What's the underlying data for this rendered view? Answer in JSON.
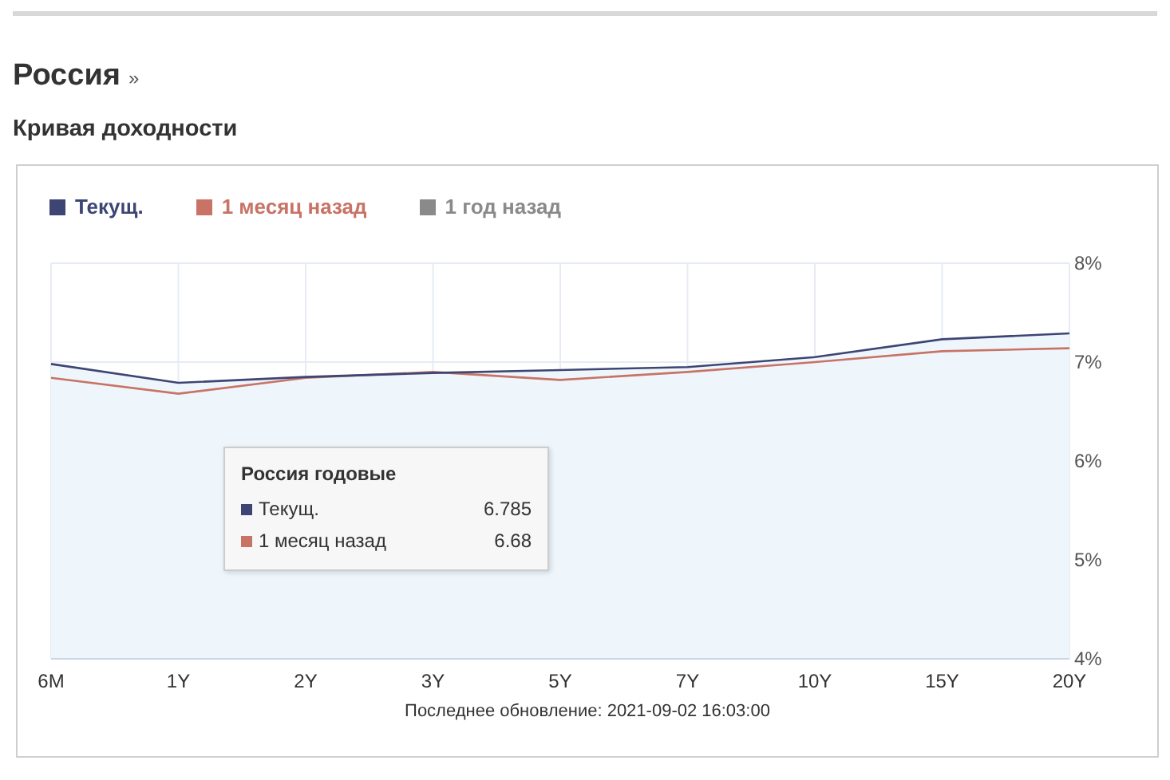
{
  "title": "Россия",
  "title_link": "»",
  "subtitle": "Кривая доходности",
  "chart": {
    "chart_data": {
      "type": "area",
      "grid": true,
      "categories": [
        "6M",
        "1Y",
        "2Y",
        "3Y",
        "5Y",
        "7Y",
        "10Y",
        "15Y",
        "20Y"
      ],
      "ylim": [
        4,
        8
      ],
      "yticks": [
        {
          "value": 4,
          "label": "4%"
        },
        {
          "value": 5,
          "label": "5%"
        },
        {
          "value": 6,
          "label": "6%"
        },
        {
          "value": 7,
          "label": "7%"
        },
        {
          "value": 8,
          "label": "8%"
        }
      ],
      "series": [
        {
          "name": "Текущ.",
          "type": "area",
          "color": "#3d4574",
          "values": [
            6.98,
            6.79,
            6.85,
            6.89,
            6.92,
            6.95,
            7.05,
            7.23,
            7.29
          ]
        },
        {
          "name": "1 месяц назад",
          "type": "line",
          "color": "#c87366",
          "values": [
            6.84,
            6.68,
            6.84,
            6.9,
            6.82,
            6.9,
            7.0,
            7.11,
            7.14
          ]
        },
        {
          "name": "1 год назад",
          "type": "line",
          "color": "#8a8a8a",
          "values": [
            null,
            null,
            null,
            null,
            null,
            null,
            null,
            null,
            null
          ]
        }
      ]
    },
    "tooltip": {
      "title": "Россия годовые",
      "rows": [
        {
          "name": "Текущ.",
          "value": "6.785",
          "color": "#3d4574"
        },
        {
          "name": "1 месяц назад",
          "value": "6.68",
          "color": "#c87366"
        }
      ]
    },
    "footer": "Последнее обновление: 2021-09-02 16:03:00"
  }
}
